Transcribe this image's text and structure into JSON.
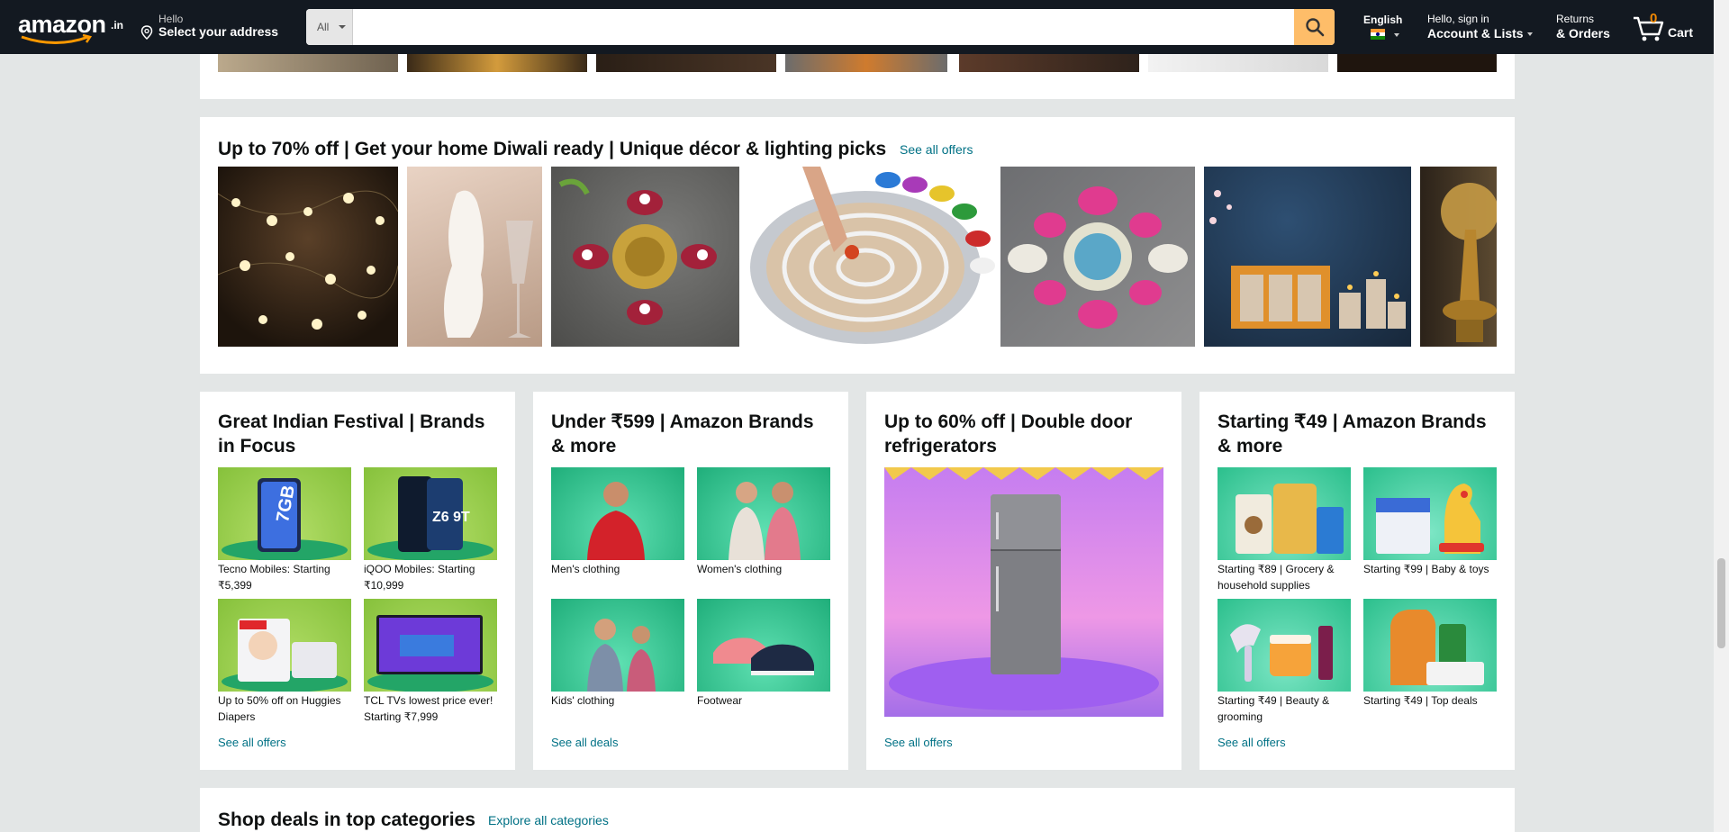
{
  "header": {
    "logo_text": "amazon",
    "logo_tld": ".in",
    "deliver_line1": "Hello",
    "deliver_line2": "Select your address",
    "search_category": "All",
    "search_placeholder": "",
    "language": "English",
    "account_line1": "Hello, sign in",
    "account_line2": "Account & Lists",
    "orders_line1": "Returns",
    "orders_line2": "& Orders",
    "cart_count": "0",
    "cart_label": "Cart",
    "colors": {
      "nav_bg": "#131921",
      "search_button": "#febd69",
      "cart_count": "#f08804",
      "link": "#007185"
    }
  },
  "diwali": {
    "title": "Up to 70% off | Get your home Diwali ready | Unique décor & lighting picks",
    "see_all": "See all offers"
  },
  "cards": [
    {
      "title": "Great Indian Festival | Brands in Focus",
      "items": [
        {
          "label": "Tecno Mobiles: Starting ₹5,399",
          "image": "tecno-phone",
          "badge": "7GB"
        },
        {
          "label": "iQOO Mobiles: Starting ₹10,999",
          "image": "iqoo-phone",
          "badge": "Z6 9T"
        },
        {
          "label": "Up to 50% off on Huggies Diapers",
          "image": "huggies-diapers"
        },
        {
          "label": "TCL TVs lowest price ever! Starting ₹7,999",
          "image": "tcl-tv"
        }
      ],
      "link": "See all offers"
    },
    {
      "title": "Under ₹599 | Amazon Brands & more",
      "items": [
        {
          "label": "Men's clothing",
          "image": "men-clothing"
        },
        {
          "label": "Women's clothing",
          "image": "women-clothing"
        },
        {
          "label": "Kids' clothing",
          "image": "kids-clothing"
        },
        {
          "label": "Footwear",
          "image": "footwear"
        }
      ],
      "link": "See all deals"
    },
    {
      "title": "Up to 60% off | Double door refrigerators",
      "items": [
        {
          "label": "",
          "image": "refrigerator"
        }
      ],
      "link": "See all offers"
    },
    {
      "title": "Starting ₹49 | Amazon Brands & more",
      "items": [
        {
          "label": "Starting ₹89 | Grocery & household supplies",
          "image": "grocery"
        },
        {
          "label": "Starting ₹99 | Baby & toys",
          "image": "baby-toys"
        },
        {
          "label": "Starting ₹49 | Beauty & grooming",
          "image": "beauty"
        },
        {
          "label": "Starting ₹49 | Top deals",
          "image": "top-deals"
        }
      ],
      "link": "See all offers"
    }
  ],
  "bottom": {
    "title": "Shop deals in top categories",
    "link": "Explore all categories"
  }
}
